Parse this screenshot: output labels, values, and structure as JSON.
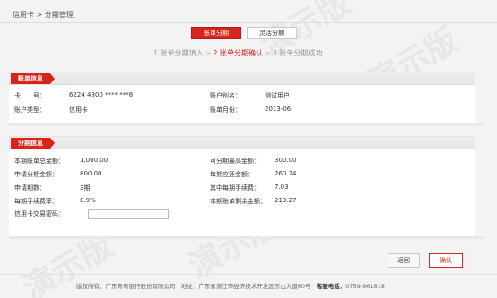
{
  "breadcrumb": "信用卡 > 分期管理",
  "tabs": [
    {
      "label": "账单分期",
      "active": true
    },
    {
      "label": "灵活分期",
      "active": false
    }
  ],
  "steps": [
    {
      "label": "1.账单分期填入",
      "active": false
    },
    {
      "label": "2.账单分期确认",
      "active": true
    },
    {
      "label": "3.账单分期成功",
      "active": false
    }
  ],
  "account_panel": {
    "title": "账单信息",
    "card_no_label": "卡　　号：",
    "card_no": "6224 4800 **** ***8",
    "alias_label": "账户别名：",
    "alias": "测试用户",
    "type_label": "账户类型：",
    "type": "信用卡",
    "month_label": "账单月份：",
    "month": "2013-06"
  },
  "installment_panel": {
    "title": "分期信息",
    "total_label": "本期账单总金额：",
    "total": "1,000.00",
    "max_label": "可分期最高金额：",
    "max": "300.00",
    "apply_label": "申请分期金额：",
    "apply": "800.00",
    "payment_label": "每期应还金额：",
    "payment": "260.24",
    "periods_label": "申请期数：",
    "periods": "3期",
    "fee_label": "其中每期手续费：",
    "fee": "7.03",
    "rate_label": "每期手续费率：",
    "rate": "0.9%",
    "remaining_label": "本期账单剩余金额：",
    "remaining": "219.27",
    "password_label": "信用卡交易密码："
  },
  "buttons": {
    "back": "返回",
    "confirm": "确认"
  },
  "footer": {
    "copyright": "版权所有：广东粤粤银行股份有限公司",
    "address": "地址：广东省湛江市经济技术开发区乐山大道60号",
    "phone_label": "客服电话：",
    "phone": "0759-961818"
  },
  "watermark_text": "演示版",
  "colors": {
    "accent": "#d9241c"
  }
}
